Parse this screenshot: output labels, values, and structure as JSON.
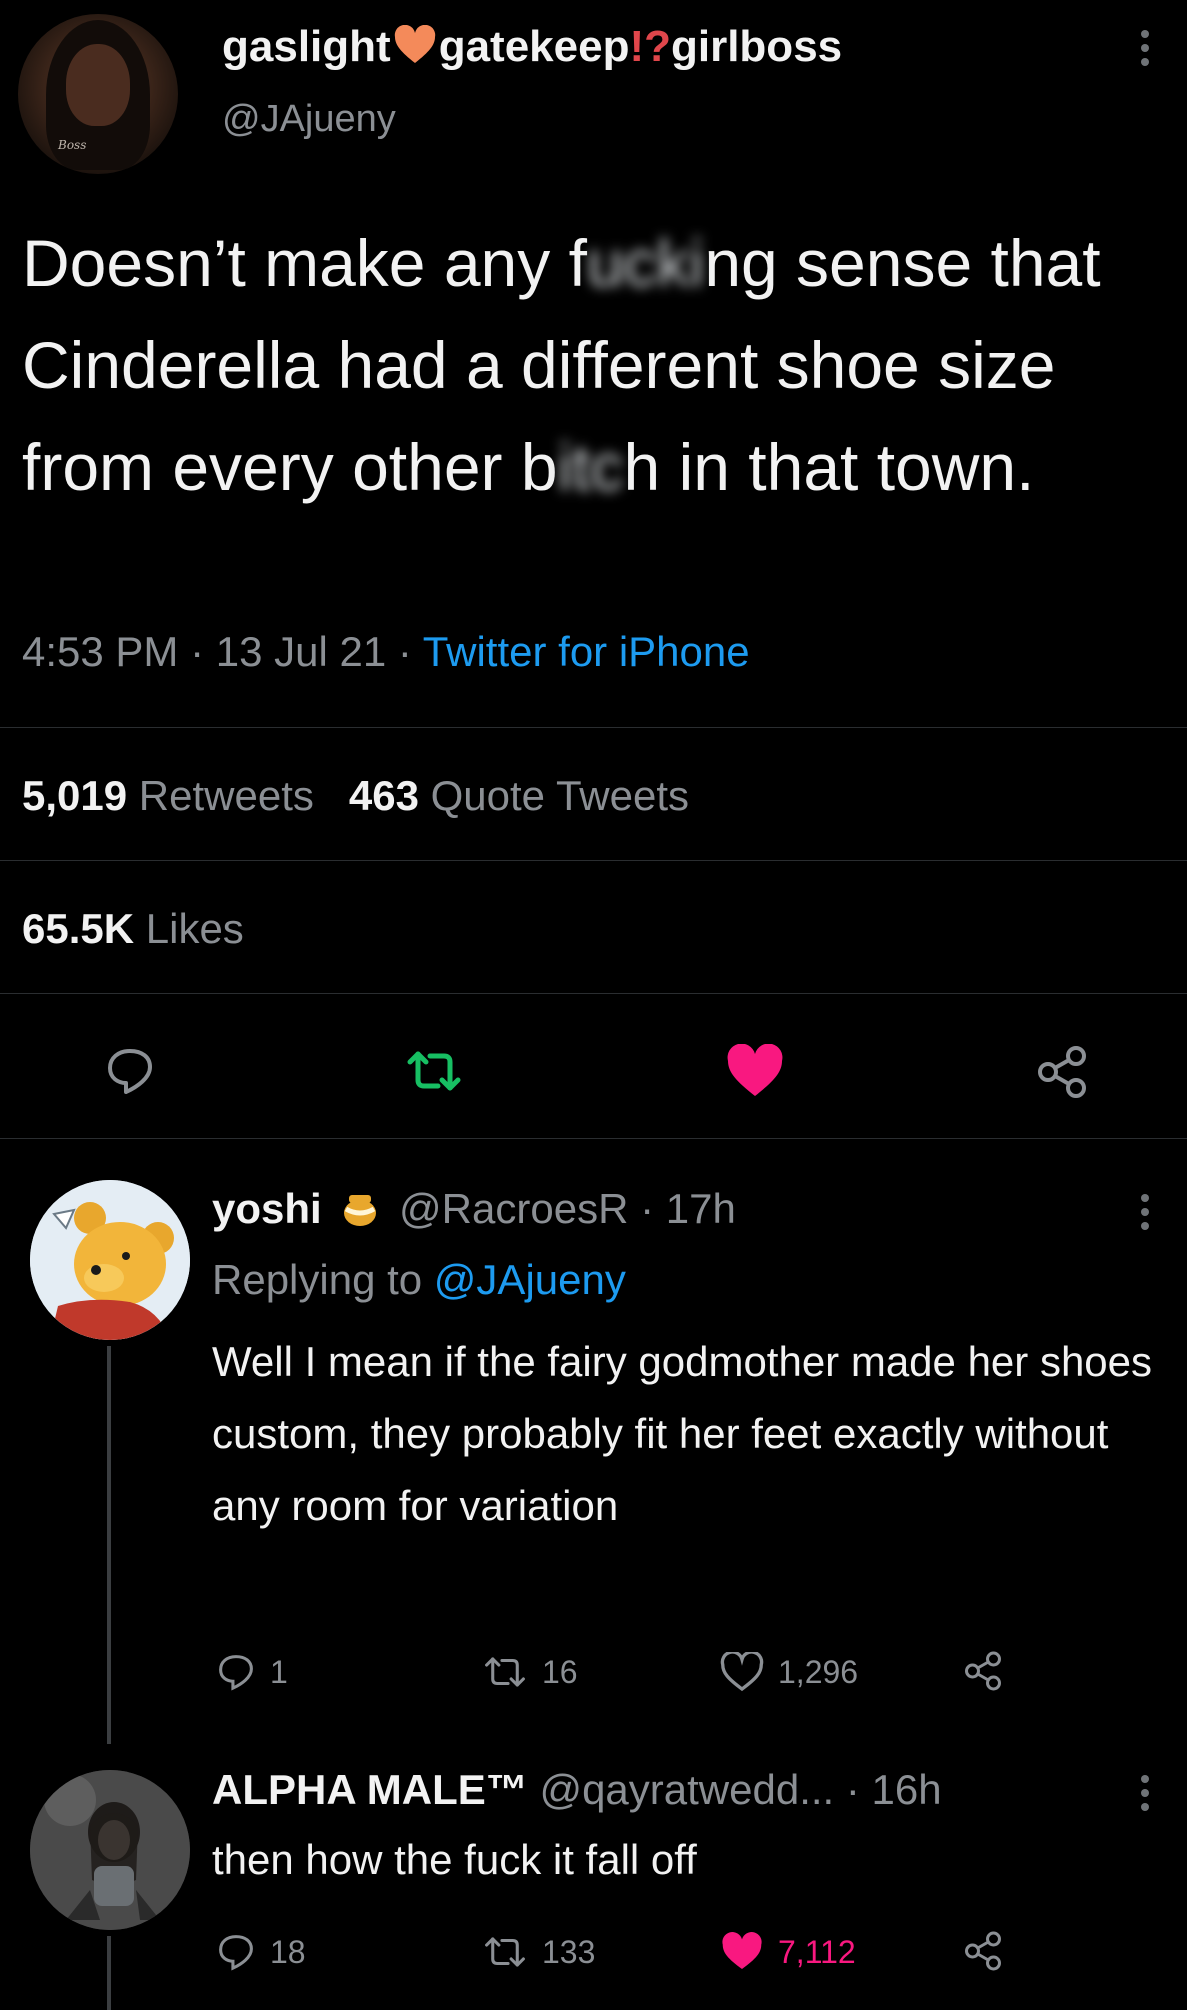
{
  "main_tweet": {
    "display_name_parts": [
      "gaslight",
      "gatekeep",
      "girlboss"
    ],
    "display_name_emoji": [
      "orange-heart-icon",
      "interrobang-icon"
    ],
    "handle": "@JAjueny",
    "avatar_caption": "Boss",
    "text": {
      "part1": "Doesn’t make any f",
      "censored1": "ucki",
      "part2": "ng sense that Cinderella had a different shoe size from every other b",
      "censored2": "itc",
      "part3": "h in that town."
    },
    "time": "4:53 PM",
    "date": "13 Jul 21",
    "source": "Twitter for iPhone",
    "retweets_count": "5,019",
    "retweets_label": "Retweets",
    "quotes_count": "463",
    "quotes_label": "Quote Tweets",
    "likes_count": "65.5K",
    "likes_label": "Likes",
    "colors": {
      "retweet": "#17bf63",
      "like": "#f91880",
      "link": "#1d9bf0"
    }
  },
  "replies": [
    {
      "name": "yoshi",
      "badge_icon": "honey-pot-icon",
      "handle": "@RacroesR",
      "time": "17h",
      "replying_label": "Replying to",
      "replying_handle": "@JAjueny",
      "text": "Well I mean if the fairy godmother made her shoes custom, they probably fit her feet exactly without any room for variation",
      "replies": "1",
      "retweets": "16",
      "likes": "1,296",
      "liked": false
    },
    {
      "name": "ALPHA MALE™",
      "handle": "@qayratwedd...",
      "time": "16h",
      "text": "then how the fuck it fall off",
      "replies": "18",
      "retweets": "133",
      "likes": "7,112",
      "liked": true
    }
  ]
}
